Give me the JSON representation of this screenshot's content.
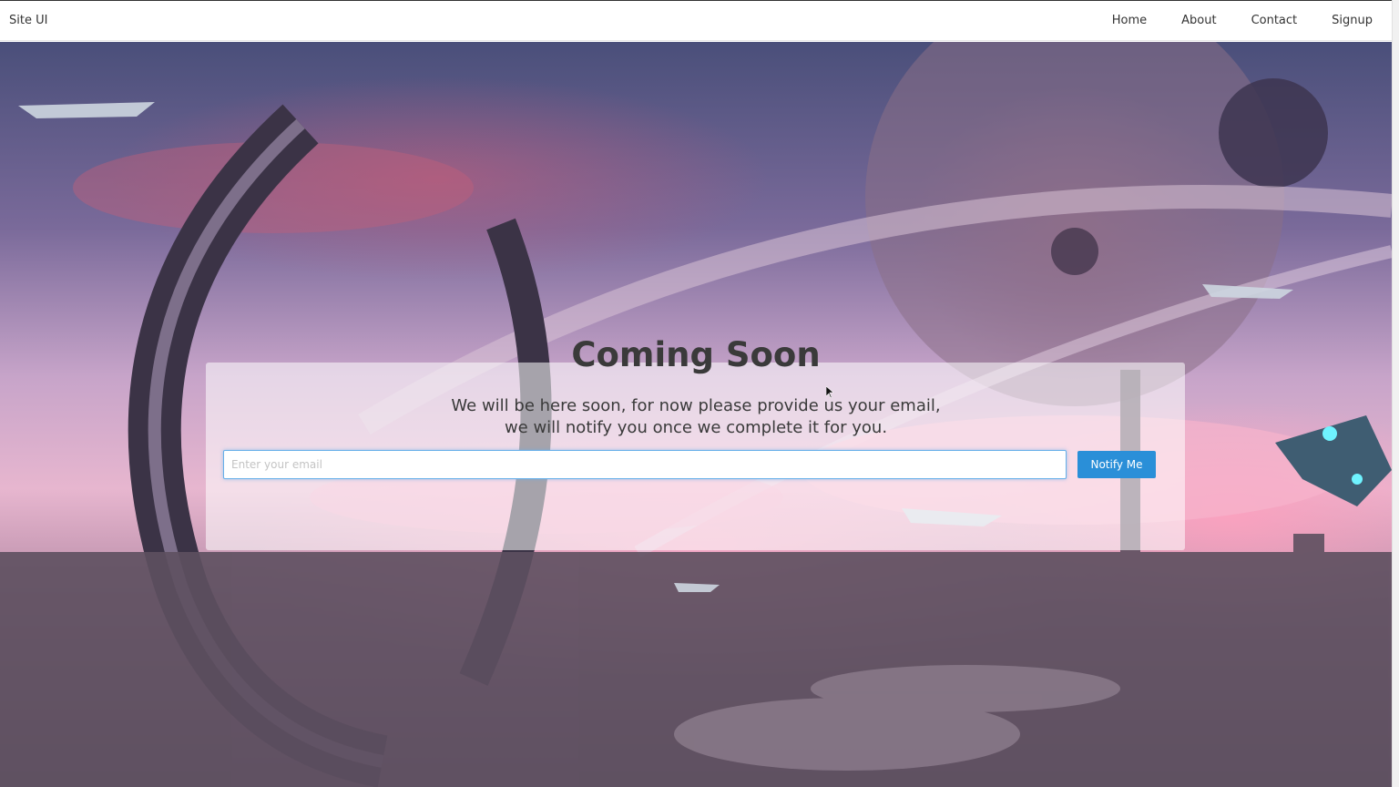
{
  "navbar": {
    "brand": "Site UI",
    "links": [
      "Home",
      "About",
      "Contact",
      "Signup"
    ]
  },
  "hero": {
    "title": "Coming Soon",
    "text_line1": "We will be here soon, for now please provide us your email,",
    "text_line2": "we will notify you once we complete it for you.",
    "email_placeholder": "Enter your email",
    "button_label": "Notify Me"
  },
  "colors": {
    "accent": "#2a8fd8",
    "text": "#3a3a3a"
  }
}
